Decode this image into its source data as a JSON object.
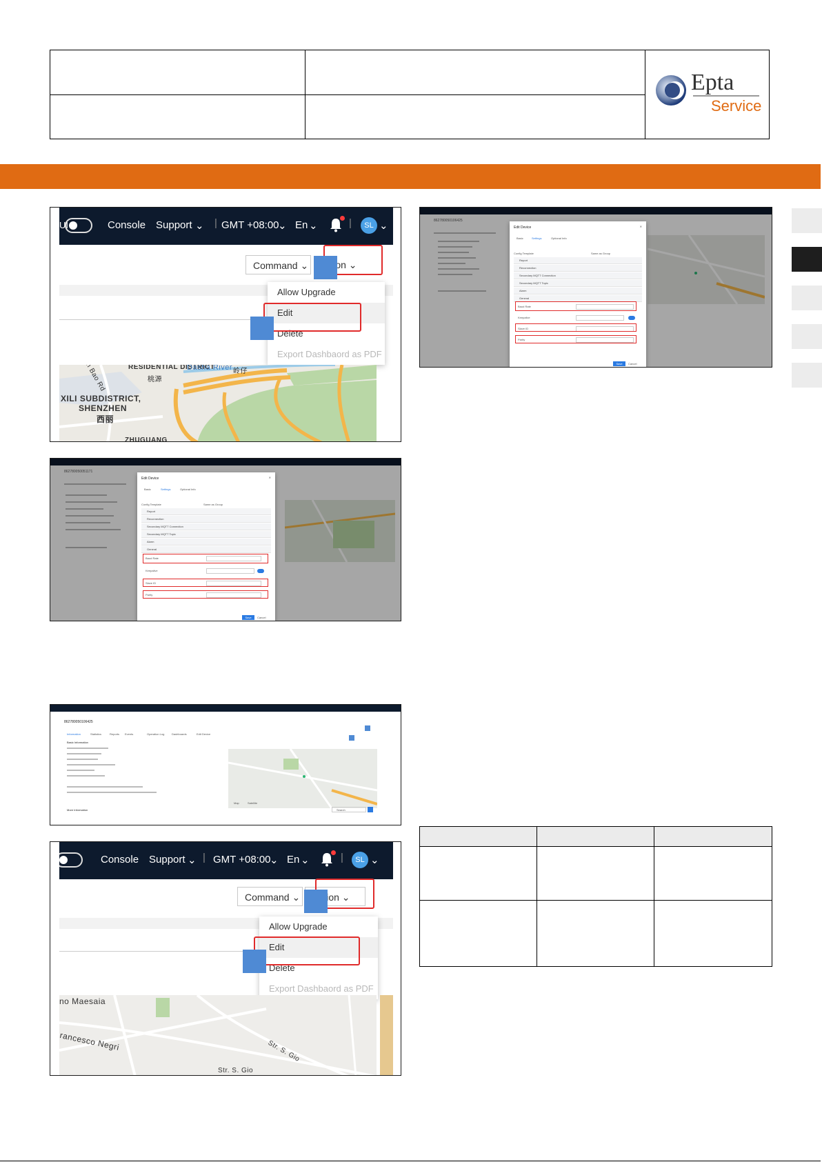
{
  "logo": {
    "brand": "Epta",
    "sub": "Service"
  },
  "nav": {
    "toggle_label": "UI",
    "console": "Console",
    "support": "Support",
    "timezone": "GMT +08:00",
    "lang": "En",
    "avatar": "SL"
  },
  "buttons": {
    "command": "Command",
    "action": "Action"
  },
  "action_menu": {
    "items": [
      "Allow Upgrade",
      "Edit",
      "Delete",
      "Export Dashbaord as PDF"
    ]
  },
  "map1": {
    "labels": [
      "RESIDENTIAL DISTRICT",
      "桃源",
      "Dasha River",
      "岭仔",
      "XILI SUBDISTRICT,",
      "SHENZHEN",
      "西丽",
      "ZHUGUANG",
      "Xin Bao Rd"
    ]
  },
  "map2": {
    "labels": [
      "no Maesaia",
      "rancesco Negri",
      "Str. S. Gio",
      "Str. S. Gio"
    ]
  },
  "dialog": {
    "title": "Edit Device",
    "tabs": [
      "Basic",
      "Settings",
      "Optional Info"
    ],
    "config_template": "Config Template",
    "same_as_group": "Same as Group",
    "sections": [
      "Report",
      "Reconnection",
      "Secondary MQTT Connection",
      "Secondary MQTT Topic",
      "Alarm",
      "General"
    ],
    "fields": [
      "Baud Rate",
      "Keepalive",
      "Slave ID",
      "Parity"
    ],
    "save": "Save",
    "cancel": "Cancel"
  },
  "small_shot1": {
    "device_id": "862780050051171"
  },
  "small_shot2": {
    "device_id": "862780050106425"
  },
  "small_shot3": {
    "device_id": "862780050106425",
    "tabs": [
      "Information",
      "Statistics",
      "Reports",
      "Events",
      "Operation Log",
      "Dashboards",
      "Edit Device"
    ],
    "section": "Basic Information",
    "more": "More Information",
    "map_tabs": [
      "Map",
      "Satellite"
    ],
    "search": "Search"
  }
}
